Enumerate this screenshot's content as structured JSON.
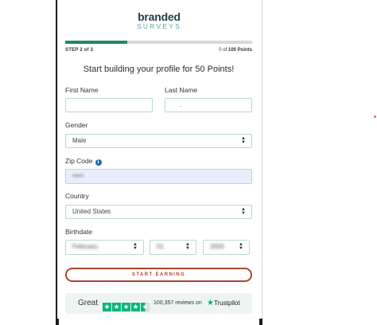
{
  "logo": {
    "top": "branded",
    "bottom": "SURVEYS"
  },
  "progress": {
    "step": "STEP 2 of 3",
    "points_prefix": "0 of ",
    "points_value": "100 Points",
    "fraction": 0.33
  },
  "heading": "Start building your profile for 50 Points!",
  "form": {
    "first_name_label": "First Name",
    "first_name_value": "",
    "last_name_label": "Last Name",
    "last_name_value": ".",
    "gender_label": "Gender",
    "gender_value": "Male",
    "zip_label": "Zip Code",
    "zip_value": "•••••",
    "country_label": "Country",
    "country_value": "United States",
    "birthdate_label": "Birthdate",
    "birth_month": "February",
    "birth_day": "01",
    "birth_year": "2000"
  },
  "cta": "START EARNING",
  "trustpilot": {
    "word": "Great",
    "reviews": "100,357 reviews on",
    "brand": "Trustpilot",
    "rating_stars": 4.5
  },
  "colors": {
    "accent": "#1e8a5f",
    "cta": "#b0452f",
    "trust_green": "#00b67a",
    "logo_dark": "#1f3b46",
    "logo_teal": "#5aa39a"
  }
}
